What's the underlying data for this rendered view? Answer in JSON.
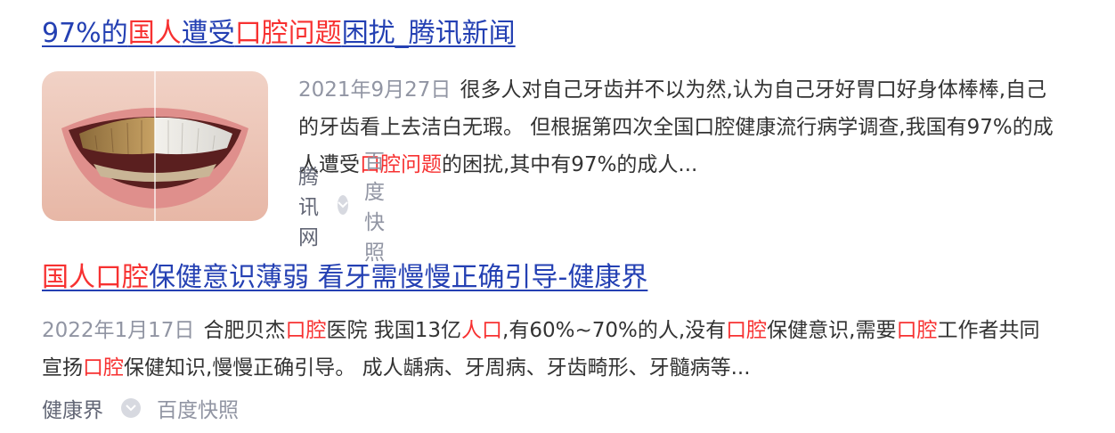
{
  "results": [
    {
      "title_parts": [
        {
          "text": "97%的",
          "hl": false
        },
        {
          "text": "国人",
          "hl": true
        },
        {
          "text": "遭受",
          "hl": false
        },
        {
          "text": "口腔问题",
          "hl": true
        },
        {
          "text": "困扰_腾讯新闻",
          "hl": false
        }
      ],
      "date": "2021年9月27日",
      "abstract_parts": [
        {
          "text": "很多人对自己牙齿并不以为然,认为自己牙好胃口好身体棒棒,自己的牙齿看上去洁白无瑕。 但根据第四次全国口腔健康流行病学调查,我国有97%的成人遭受",
          "hl": false
        },
        {
          "text": "口腔问题",
          "hl": true
        },
        {
          "text": "的困扰,其中有97%的成人...",
          "hl": false
        }
      ],
      "source": "腾讯网",
      "snapshot": "百度快照"
    },
    {
      "title_parts": [
        {
          "text": "国人口腔",
          "hl": true
        },
        {
          "text": "保健意识薄弱 看牙需慢慢正确引导-健康界",
          "hl": false
        }
      ],
      "date": "2022年1月17日",
      "abstract_parts": [
        {
          "text": "合肥贝杰",
          "hl": false
        },
        {
          "text": "口腔",
          "hl": true
        },
        {
          "text": "医院 我国13亿",
          "hl": false
        },
        {
          "text": "人口",
          "hl": true
        },
        {
          "text": ",有60%~70%的人,没有",
          "hl": false
        },
        {
          "text": "口腔",
          "hl": true
        },
        {
          "text": "保健意识,需要",
          "hl": false
        },
        {
          "text": "口腔",
          "hl": true
        },
        {
          "text": "工作者共同宣扬",
          "hl": false
        },
        {
          "text": "口腔",
          "hl": true
        },
        {
          "text": "保健知识,慢慢正确引导。 成人龋病、牙周病、牙齿畸形、牙髓病等...",
          "hl": false
        }
      ],
      "source": "健康界",
      "snapshot": "百度快照"
    }
  ],
  "icons": {
    "snapshot_badge": "chevron-down-icon"
  },
  "colors": {
    "title_link": "#2440b3",
    "highlight": "#f73131",
    "date": "#9195a3",
    "abstract": "#333333",
    "source": "#626675"
  }
}
